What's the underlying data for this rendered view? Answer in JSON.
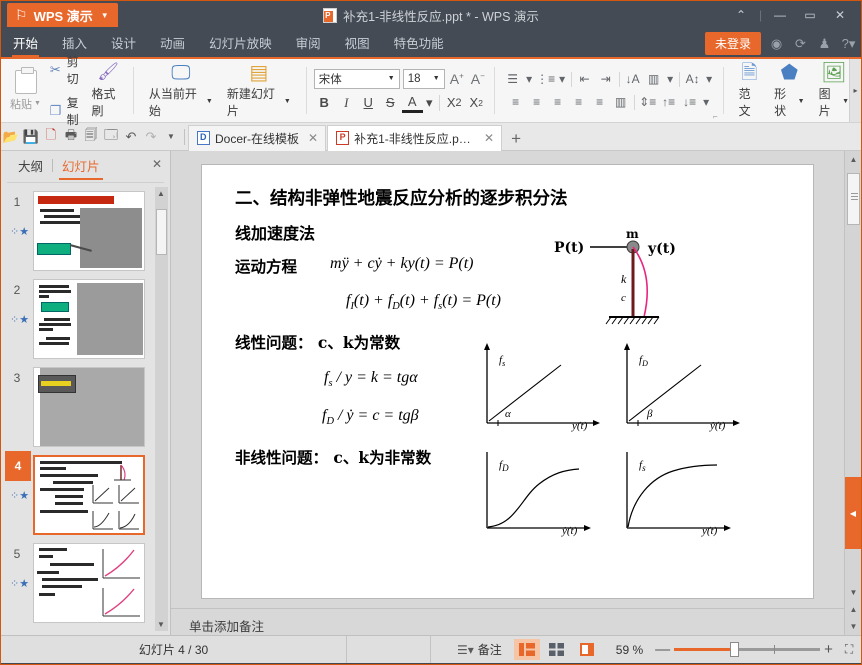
{
  "titlebar": {
    "app_badge": "WPS 演示",
    "document_title": "补充1-非线性反应.ppt * - WPS 演示",
    "collapse": "⌃",
    "minimize": "—",
    "maximize": "▭",
    "close": "✕"
  },
  "menubar": {
    "items": [
      {
        "label": "开始",
        "active": true
      },
      {
        "label": "插入",
        "active": false
      },
      {
        "label": "设计",
        "active": false
      },
      {
        "label": "动画",
        "active": false
      },
      {
        "label": "幻灯片放映",
        "active": false
      },
      {
        "label": "审阅",
        "active": false
      },
      {
        "label": "视图",
        "active": false
      },
      {
        "label": "特色功能",
        "active": false
      }
    ],
    "login_label": "未登录",
    "right_icons": [
      "globe-icon",
      "sync-icon",
      "skin-icon",
      "help-icon"
    ]
  },
  "ribbon": {
    "paste_label": "粘贴",
    "cut_label": "剪切",
    "copy_label": "复制",
    "format_painter_label": "格式刷",
    "start_from_current_label": "从当前开始",
    "new_slide_label": "新建幻灯片",
    "font_name": "宋体",
    "font_size": "18",
    "grow_font": "A",
    "shrink_font": "A",
    "bold": "B",
    "italic": "I",
    "underline": "U",
    "strike": "S",
    "font_color": "A",
    "superscript": "X",
    "subscript": "X",
    "template_label": "范文",
    "shape_label": "形状",
    "picture_label": "图片"
  },
  "quickbar": {
    "icons": [
      "open-icon",
      "save-icon",
      "export-pdf-icon",
      "print-icon",
      "print-preview-icon",
      "print-setup-icon",
      "undo-icon",
      "redo-icon",
      "customize-icon"
    ],
    "tabs": [
      {
        "label": "Docer-在线模板",
        "active": false,
        "icon": "docer-icon"
      },
      {
        "label": "补充1-非线性反应.ppt *",
        "active": true,
        "icon": "ppt-icon"
      }
    ],
    "new_tab": "+"
  },
  "sidebar": {
    "tab_outline": "大纲",
    "tab_slides": "幻灯片",
    "close": "✕",
    "active_tab": "幻灯片",
    "slides": [
      {
        "number": "1",
        "selected": false
      },
      {
        "number": "2",
        "selected": false
      },
      {
        "number": "3",
        "selected": false
      },
      {
        "number": "4",
        "selected": true
      },
      {
        "number": "5",
        "selected": false
      }
    ]
  },
  "slide": {
    "title": "二、结构非弹性地震反应分析的逐步积分法",
    "subtitle": "线加速度法",
    "eq_label_motion": "运动方程",
    "equation1": "mÿ + cẏ + ky(t) = P(t)",
    "equation2": "f_I(t) + f_D(t) + f_s(t) = P(t)",
    "linear_label": "线性问题：   c、k为常数",
    "equation3": "f_s / y = k = tgα",
    "equation4": "f_D / ẏ = c = tgβ",
    "nonlinear_label": "非线性问题：   c、k为非常数",
    "sdof": {
      "force_label": "P(t)",
      "mass_label": "m",
      "disp_label": "y(t)",
      "stiffness_label": "k",
      "damping_label": "c"
    },
    "graphs": [
      {
        "name": "linear-stiffness",
        "ylabel": "f",
        "ysub": "s",
        "xlabel": "y(t)",
        "angle": "α",
        "curve": "line"
      },
      {
        "name": "linear-damping",
        "ylabel": "f",
        "ysub": "D",
        "xlabel": "ẏ(t)",
        "angle": "β",
        "curve": "line"
      },
      {
        "name": "nonlinear-damping",
        "ylabel": "f",
        "ysub": "D",
        "xlabel": "ẏ(t)",
        "angle": "",
        "curve": "s-curve"
      },
      {
        "name": "nonlinear-stiffness",
        "ylabel": "f",
        "ysub": "s",
        "xlabel": "y(t)",
        "angle": "",
        "curve": "concave"
      }
    ]
  },
  "notes": {
    "placeholder": "单击添加备注"
  },
  "status": {
    "slide_info": "幻灯片 4 / 30",
    "notes_label": "备注",
    "zoom_percent": "59 %",
    "zoom_out": "—",
    "zoom_in": "+",
    "fit_label": "⛶",
    "views": [
      "normal-view",
      "slide-sorter-view",
      "reading-view"
    ]
  },
  "colors": {
    "accent": "#e8682c",
    "titlebar": "#444b55",
    "ribbon_bg": "#f6f6f6",
    "canvas_bg": "#d8d8d8"
  }
}
